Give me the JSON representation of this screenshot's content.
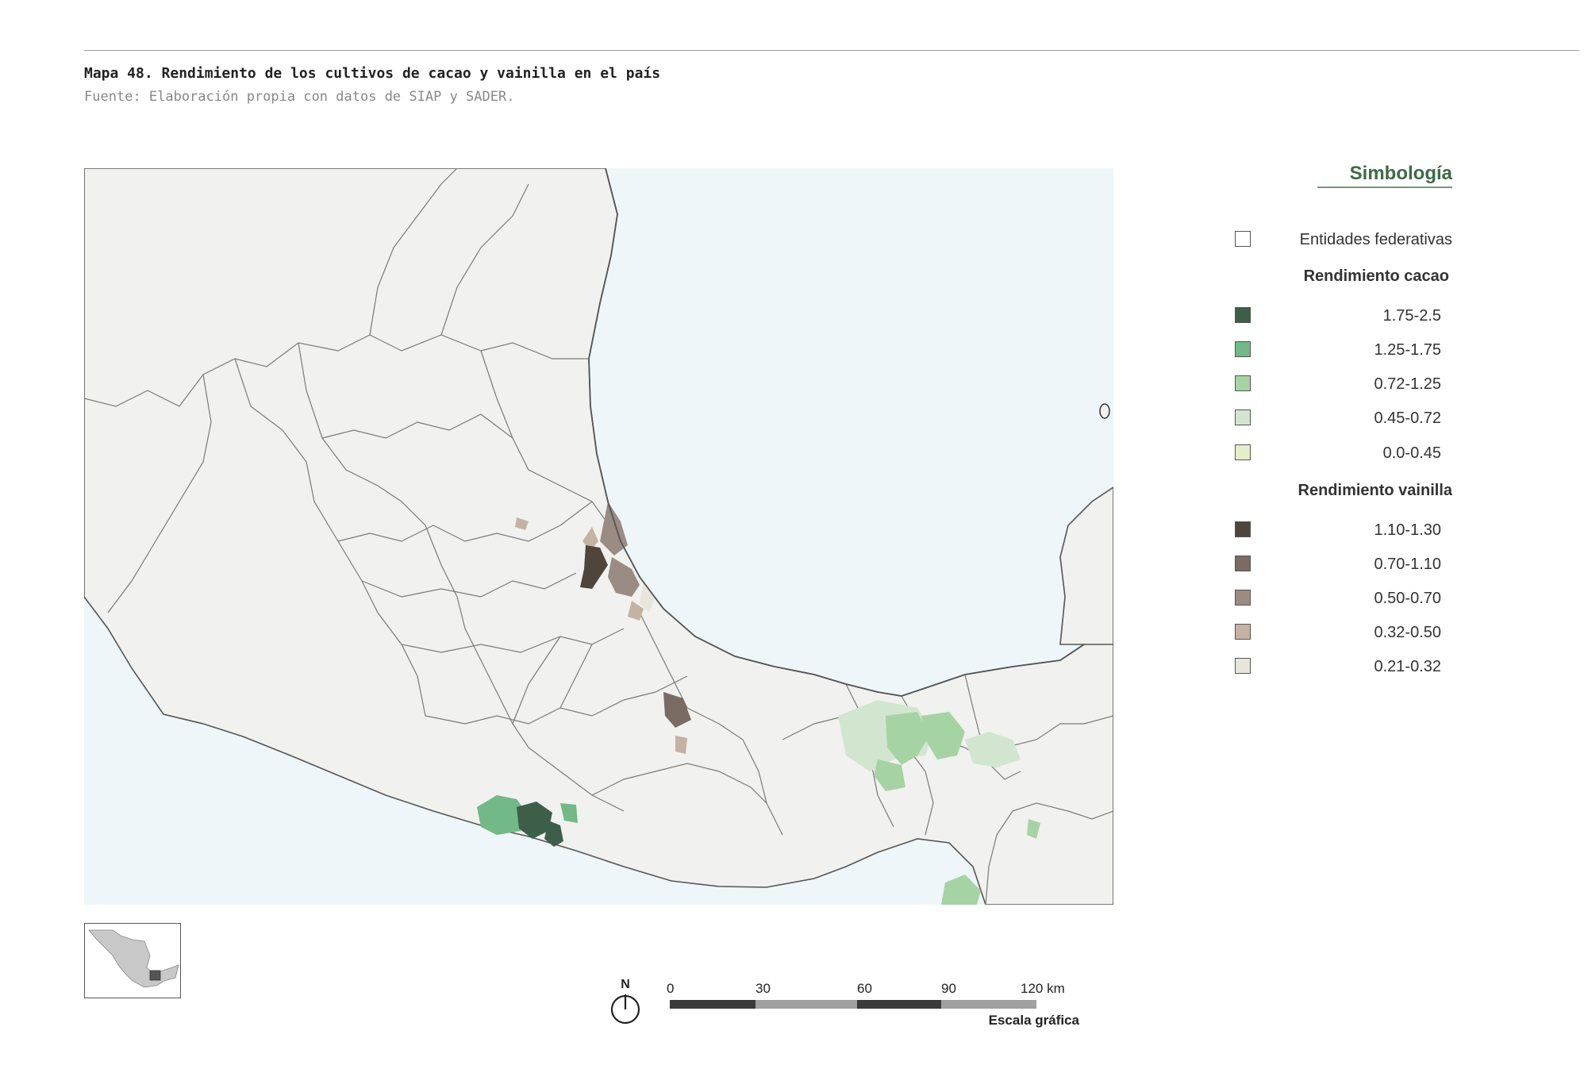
{
  "header": {
    "title": "Mapa 48. Rendimiento de los cultivos de cacao y vainilla en el país",
    "source": "Fuente: Elaboración propia con datos de SIAP y SADER."
  },
  "legend": {
    "title": "Simbología",
    "states_label": "Entidades federativas",
    "states_color": "#ffffff",
    "cacao": {
      "heading": "Rendimiento cacao",
      "classes": [
        {
          "label": "1.75-2.5",
          "color": "#3d5e49"
        },
        {
          "label": "1.25-1.75",
          "color": "#73b887"
        },
        {
          "label": "0.72-1.25",
          "color": "#a6d3a3"
        },
        {
          "label": "0.45-0.72",
          "color": "#d2e6cf"
        },
        {
          "label": "0.0-0.45",
          "color": "#e4efc9"
        }
      ]
    },
    "vainilla": {
      "heading": "Rendimiento vainilla",
      "classes": [
        {
          "label": "1.10-1.30",
          "color": "#4e463b"
        },
        {
          "label": "0.70-1.10",
          "color": "#7a6b63"
        },
        {
          "label": "0.50-0.70",
          "color": "#9a8b83"
        },
        {
          "label": "0.32-0.50",
          "color": "#c4b2a2"
        },
        {
          "label": "0.21-0.32",
          "color": "#e8e6dc"
        }
      ]
    }
  },
  "scale": {
    "ticks": [
      "0",
      "30",
      "60",
      "90",
      "120 km"
    ],
    "caption": "Escala gráfica",
    "colors": [
      "#3a3a3a",
      "#a0a0a0"
    ]
  },
  "north": {
    "label": "N",
    "icon": "north-arrow-icon"
  },
  "map": {
    "sea_color": "#eef6fa",
    "land_color": "#f1f1ef",
    "border_color": "#6b6b6b"
  }
}
